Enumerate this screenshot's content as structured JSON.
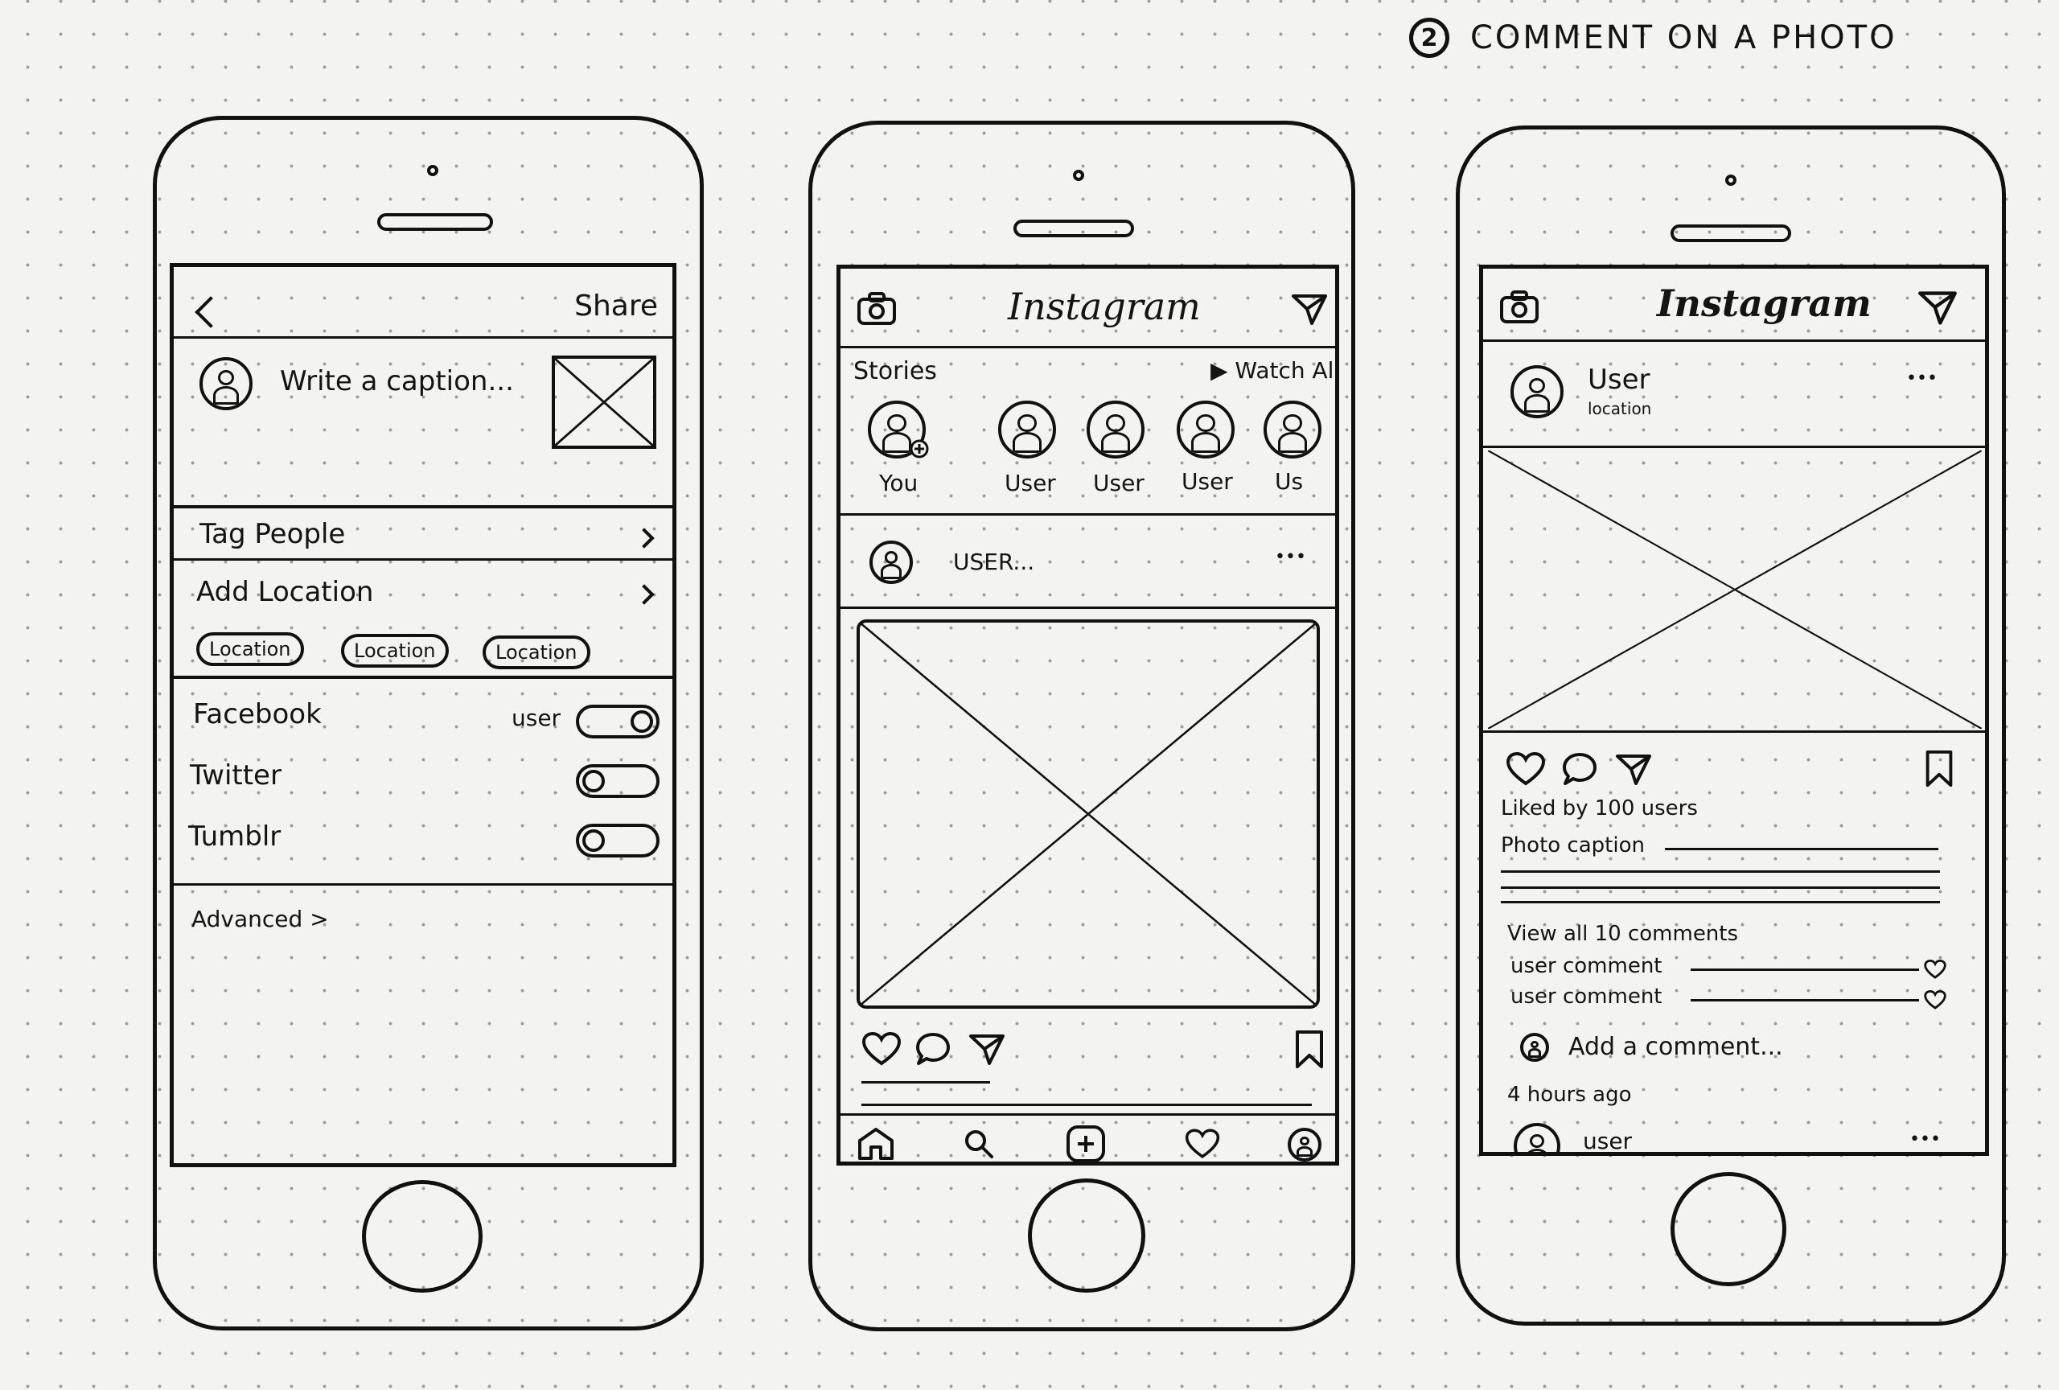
{
  "annotation": {
    "number": "2",
    "title": "COMMENT ON A PHOTO"
  },
  "share_screen": {
    "back_icon": "chevron-left-icon",
    "share_label": "Share",
    "caption_placeholder": "Write a caption...",
    "tag_people_label": "Tag People",
    "add_location_label": "Add Location",
    "location_chips": [
      "Location",
      "Location",
      "Location"
    ],
    "social_accounts": [
      {
        "name": "Facebook",
        "account": "user",
        "enabled": true
      },
      {
        "name": "Twitter",
        "account": "",
        "enabled": false
      },
      {
        "name": "Tumblr",
        "account": "",
        "enabled": false
      }
    ],
    "advanced_label": "Advanced >"
  },
  "feed_screen": {
    "camera_icon": "camera-icon",
    "app_title": "Instagram",
    "direct_icon": "paper-plane-icon",
    "stories_label": "Stories",
    "watch_all_label": "▶ Watch All",
    "stories": [
      "You",
      "User",
      "User",
      "User",
      "Us"
    ],
    "post_username": "USER...",
    "post_menu_glyph": "•••",
    "bottom_nav": [
      "home-icon",
      "search-icon",
      "add-post-icon",
      "activity-heart-icon",
      "profile-icon"
    ]
  },
  "detail_screen": {
    "camera_icon": "camera-icon",
    "app_title": "Instagram",
    "direct_icon": "paper-plane-icon",
    "username": "User",
    "location": "location",
    "menu_glyph": "•••",
    "likes_text": "Liked by 100 users",
    "caption_text": "Photo caption",
    "view_comments_text": "View all 10 comments",
    "comments": [
      "user comment",
      "user comment"
    ],
    "add_comment_placeholder": "Add a comment...",
    "timestamp": "4 hours ago",
    "next_username": "user",
    "next_menu_glyph": "•••"
  }
}
